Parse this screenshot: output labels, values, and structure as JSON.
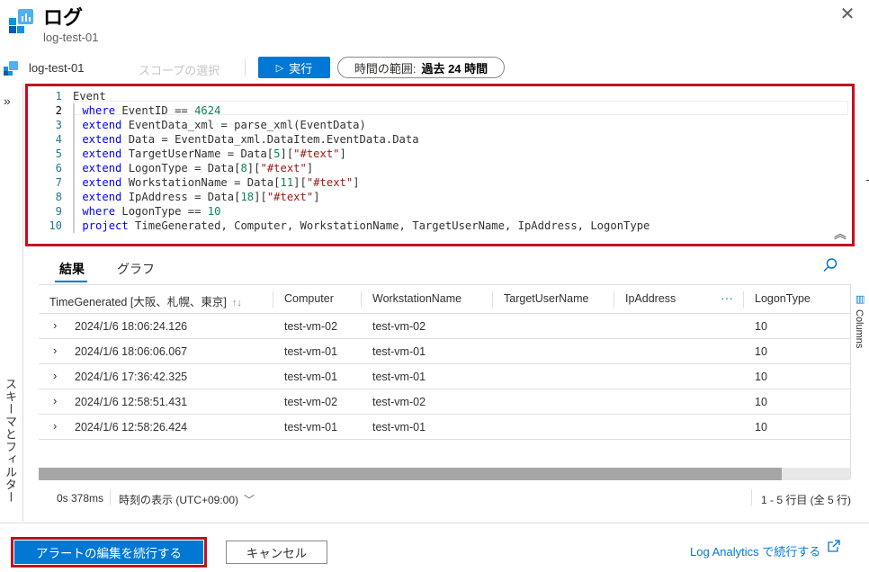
{
  "header": {
    "title": "ログ",
    "subtitle": "log-test-01",
    "close_icon": "close-icon"
  },
  "toolbar": {
    "workspace": "log-test-01",
    "scope": "スコープの選択",
    "run_label": "実行",
    "time_range_label": "時間の範囲:",
    "time_range_value": "過去 24 時間"
  },
  "sidebar": {
    "vertical_label": "スキーマとフィルター"
  },
  "editor": {
    "lines": [
      {
        "n": "1",
        "tokens": [
          [
            "p",
            "Event"
          ]
        ]
      },
      {
        "n": "2",
        "tokens": [
          [
            "bar",
            ""
          ],
          [
            "k",
            "where"
          ],
          [
            "p",
            " EventID == "
          ],
          [
            "n",
            "4624"
          ]
        ]
      },
      {
        "n": "3",
        "tokens": [
          [
            "bar",
            ""
          ],
          [
            "k",
            "extend"
          ],
          [
            "p",
            " EventData_xml = parse_xml(EventData)"
          ]
        ]
      },
      {
        "n": "4",
        "tokens": [
          [
            "bar",
            ""
          ],
          [
            "k",
            "extend"
          ],
          [
            "p",
            " Data = EventData_xml.DataItem.EventData.Data"
          ]
        ]
      },
      {
        "n": "5",
        "tokens": [
          [
            "bar",
            ""
          ],
          [
            "k",
            "extend"
          ],
          [
            "p",
            " TargetUserName = Data["
          ],
          [
            "n",
            "5"
          ],
          [
            "p",
            "]["
          ],
          [
            "s",
            "\"#text\""
          ],
          [
            "p",
            "]"
          ]
        ]
      },
      {
        "n": "6",
        "tokens": [
          [
            "bar",
            ""
          ],
          [
            "k",
            "extend"
          ],
          [
            "p",
            " LogonType = Data["
          ],
          [
            "n",
            "8"
          ],
          [
            "p",
            "]["
          ],
          [
            "s",
            "\"#text\""
          ],
          [
            "p",
            "]"
          ]
        ]
      },
      {
        "n": "7",
        "tokens": [
          [
            "bar",
            ""
          ],
          [
            "k",
            "extend"
          ],
          [
            "p",
            " WorkstationName = Data["
          ],
          [
            "n",
            "11"
          ],
          [
            "p",
            "]["
          ],
          [
            "s",
            "\"#text\""
          ],
          [
            "p",
            "]"
          ]
        ]
      },
      {
        "n": "8",
        "tokens": [
          [
            "bar",
            ""
          ],
          [
            "k",
            "extend"
          ],
          [
            "p",
            " IpAddress = Data["
          ],
          [
            "n",
            "18"
          ],
          [
            "p",
            "]["
          ],
          [
            "s",
            "\"#text\""
          ],
          [
            "p",
            "]"
          ]
        ]
      },
      {
        "n": "9",
        "tokens": [
          [
            "bar",
            ""
          ],
          [
            "k",
            "where"
          ],
          [
            "p",
            " LogonType == "
          ],
          [
            "n",
            "10"
          ]
        ]
      },
      {
        "n": "10",
        "tokens": [
          [
            "bar",
            ""
          ],
          [
            "k",
            "project"
          ],
          [
            "p",
            " TimeGenerated, Computer, WorkstationName, TargetUserName, IpAddress, LogonType"
          ]
        ]
      }
    ]
  },
  "results": {
    "tabs": [
      "結果",
      "グラフ"
    ],
    "columns": [
      "TimeGenerated [大阪、札幌、東京]",
      "Computer",
      "WorkstationName",
      "TargetUserName",
      "IpAddress",
      "LogonType"
    ],
    "rows": [
      [
        "2024/1/6 18:06:24.126",
        "test-vm-02",
        "test-vm-02",
        "",
        "",
        "10"
      ],
      [
        "2024/1/6 18:06:06.067",
        "test-vm-01",
        "test-vm-01",
        "",
        "",
        "10"
      ],
      [
        "2024/1/6 17:36:42.325",
        "test-vm-01",
        "test-vm-01",
        "",
        "",
        "10"
      ],
      [
        "2024/1/6 12:58:51.431",
        "test-vm-02",
        "test-vm-02",
        "",
        "",
        "10"
      ],
      [
        "2024/1/6 12:58:26.424",
        "test-vm-01",
        "test-vm-01",
        "",
        "",
        "10"
      ]
    ],
    "columns_panel_label": "Columns",
    "more": "···"
  },
  "status": {
    "duration": "0s 378ms",
    "time_display": "時刻の表示 (UTC+09:00)",
    "range": "1 - 5 行目 (全 5 行)"
  },
  "footer": {
    "primary": "アラートの編集を続行する",
    "cancel": "キャンセル",
    "link": "Log Analytics で続行する"
  },
  "colors": {
    "accent": "#0078d4",
    "highlight_border": "#c50f1f"
  }
}
